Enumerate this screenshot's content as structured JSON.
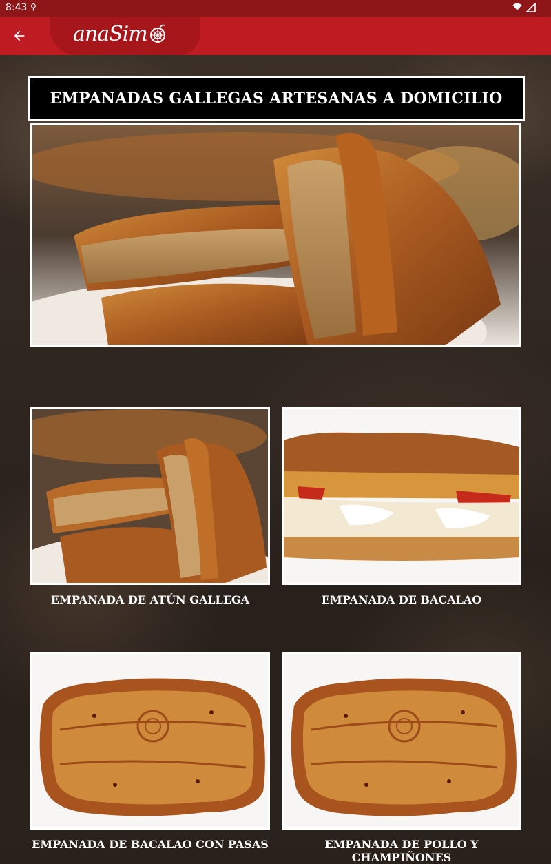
{
  "status_bar": {
    "time": "8:43"
  },
  "app_bar": {
    "logo_text": "anaSim"
  },
  "title": "EMPANADAS GALLEGAS ARTESANAS A DOMICILIO",
  "products": [
    {
      "name": "EMPANADA DE ATÚN GALLEGA"
    },
    {
      "name": "EMPANADA DE BACALAO"
    },
    {
      "name": "EMPANADA DE BACALAO CON PASAS"
    },
    {
      "name": "EMPANADA DE POLLO Y CHAMPIÑONES"
    }
  ],
  "colors": {
    "status_bar": "#8e1518",
    "app_bar": "#be1c22",
    "title_bg": "#000000",
    "border": "#ffffff"
  },
  "icons": {
    "back": "arrow-back-icon",
    "wifi": "wifi-icon",
    "signal": "signal-icon",
    "logo": "logo-flower-icon"
  }
}
